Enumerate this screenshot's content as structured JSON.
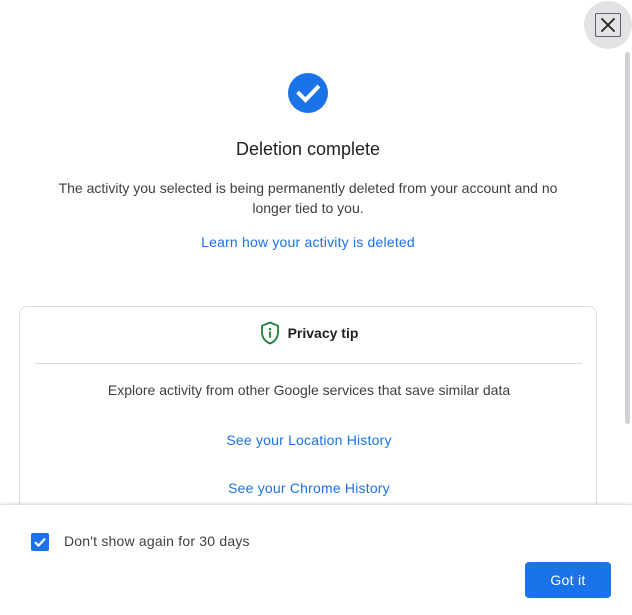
{
  "dialog": {
    "title": "Deletion complete",
    "description": "The activity you selected is being permanently deleted from your account and no longer tied to you.",
    "learn_link": "Learn how your activity is deleted"
  },
  "privacy_tip": {
    "title": "Privacy tip",
    "explore_text": "Explore activity from other Google services that save similar data",
    "links": [
      "See your Location History",
      "See your Chrome History"
    ]
  },
  "footer": {
    "checkbox_label": "Don't show again for 30 days",
    "checkbox_checked": true,
    "got_it_label": "Got it"
  },
  "icons": {
    "close": "close-icon",
    "success": "check-circle-icon",
    "shield": "shield-info-icon",
    "checkbox": "checkmark-icon"
  },
  "colors": {
    "accent": "#1a73e8",
    "shield": "#188038",
    "text_primary": "#202124",
    "text_secondary": "#3c4043"
  }
}
